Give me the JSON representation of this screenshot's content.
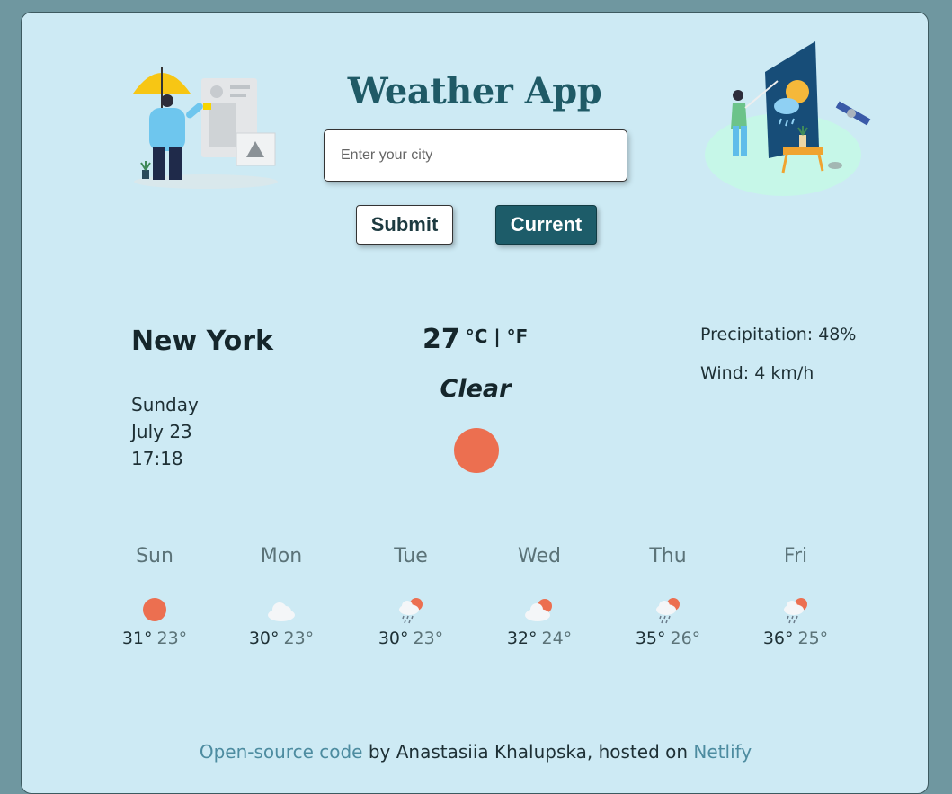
{
  "colors": {
    "page_bg": "#6f97a0",
    "card_bg": "#cdeaf4",
    "title": "#1f5a66",
    "accent": "#1d5c69",
    "sun": "#ec6f50",
    "link": "#4d8ca0"
  },
  "header": {
    "title": "Weather App",
    "search_placeholder": "Enter your city",
    "submit_label": "Submit",
    "current_label": "Current"
  },
  "current": {
    "city": "New York",
    "day": "Sunday",
    "date": "July 23",
    "time": "17:18",
    "temperature": "27",
    "units": "°C | °F",
    "description": "Clear",
    "icon": "sun-icon",
    "precipitation": "Precipitation: 48%",
    "wind": "Wind: 4 km/h"
  },
  "forecast": [
    {
      "day": "Sun",
      "max": "31°",
      "min": "23°",
      "icon": "sun-icon"
    },
    {
      "day": "Mon",
      "max": "30°",
      "min": "23°",
      "icon": "cloud-icon"
    },
    {
      "day": "Tue",
      "max": "30°",
      "min": "23°",
      "icon": "rain-sun-icon"
    },
    {
      "day": "Wed",
      "max": "32°",
      "min": "24°",
      "icon": "cloud-sun-icon"
    },
    {
      "day": "Thu",
      "max": "35°",
      "min": "26°",
      "icon": "rain-sun-icon"
    },
    {
      "day": "Fri",
      "max": "36°",
      "min": "25°",
      "icon": "rain-sun-icon"
    }
  ],
  "footer": {
    "code_link": "Open-source code",
    "middle": " by Anastasiia Khalupska, hosted on ",
    "host_link": "Netlify"
  }
}
